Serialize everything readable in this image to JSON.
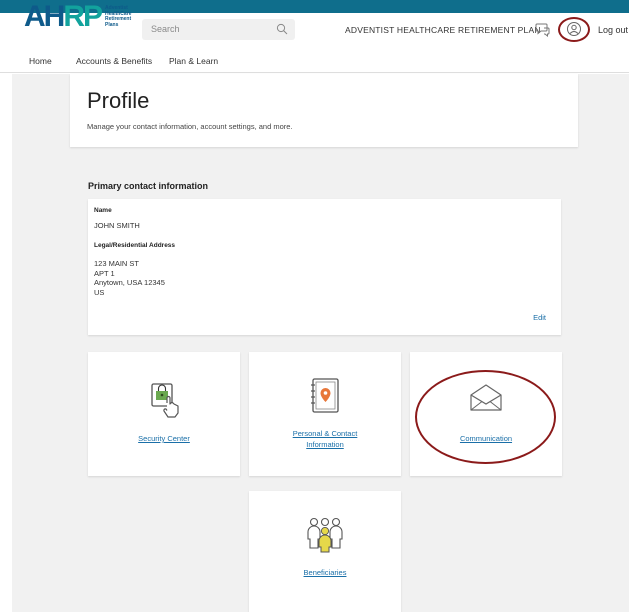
{
  "header": {
    "logo_text": "AHRP",
    "logo_subtext": [
      "Adventist",
      "HealthCare",
      "Retirement",
      "Plans"
    ],
    "search_placeholder": "Search",
    "plan_name": "ADVENTIST HEALTHCARE RETIREMENT PLAN",
    "logout_label": "Log out"
  },
  "nav": {
    "items": [
      "Home",
      "Accounts & Benefits",
      "Plan & Learn"
    ]
  },
  "profile": {
    "title": "Profile",
    "subtitle": "Manage your contact information, account settings, and more."
  },
  "contact": {
    "heading": "Primary contact information",
    "name_label": "Name",
    "name_value": "JOHN SMITH",
    "address_label": "Legal/Residential Address",
    "address_lines": [
      "123 MAIN ST",
      "APT 1",
      "Anytown, USA 12345",
      "US"
    ],
    "edit_label": "Edit"
  },
  "tiles": [
    {
      "label": "Security Center",
      "icon": "lock-touch-icon"
    },
    {
      "label_lines": [
        "Personal & Contact",
        "Information"
      ],
      "icon": "address-book-icon"
    },
    {
      "label": "Communication",
      "icon": "envelope-icon"
    },
    {
      "label": "Beneficiaries",
      "icon": "people-icon"
    }
  ],
  "colors": {
    "brand_dark": "#0e5a8a",
    "brand_teal": "#12a39d",
    "link": "#1a6fa8",
    "highlight_ring": "#8b1a1a",
    "accent_orange": "#e8773a",
    "accent_green": "#6aa84f",
    "accent_yellow": "#e6d84a"
  }
}
